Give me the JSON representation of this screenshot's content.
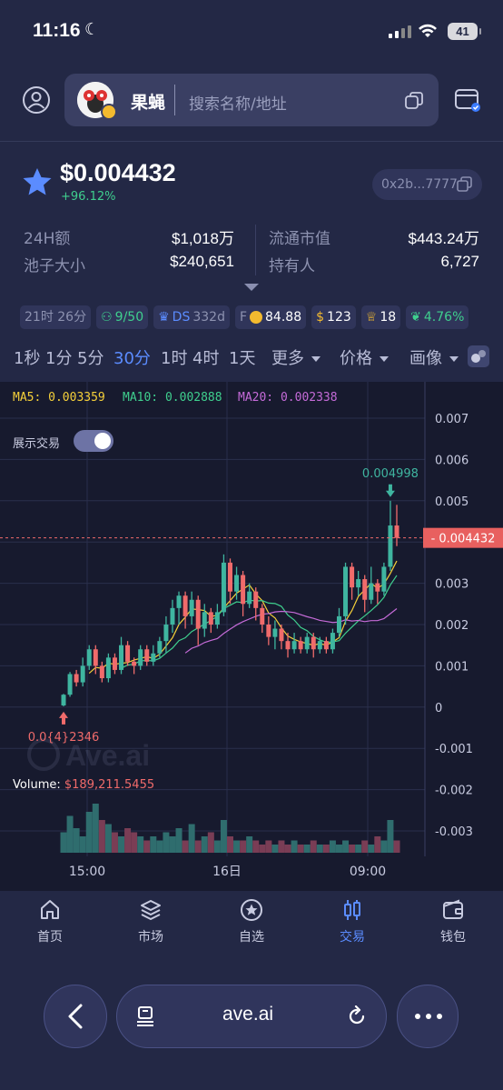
{
  "status_bar": {
    "time": "11:16",
    "battery": "41"
  },
  "header": {
    "token_name": "果蝇",
    "search_placeholder": "搜索名称/地址"
  },
  "token": {
    "price": "$0.004432",
    "change": "+96.12%",
    "address": "0x2b...7777",
    "stats": [
      {
        "label": "24H额",
        "value": "$1,018万"
      },
      {
        "label": "池子大小",
        "value": "$240,651"
      },
      {
        "label": "流通市值",
        "value": "$443.24万"
      },
      {
        "label": "持有人",
        "value": "6,727"
      }
    ],
    "chips": [
      "21时 26分",
      "9/50",
      "DS",
      "332d",
      "F",
      "84.88",
      "123",
      "18",
      "4.76%"
    ]
  },
  "timeframes": [
    "1秒",
    "1分",
    "5分",
    "30分",
    "1时",
    "4时",
    "1天"
  ],
  "active_timeframe": "30分",
  "dropdowns": [
    "更多",
    "价格",
    "画像"
  ],
  "chart_labels": {
    "ma5": "MA5: 0.003359",
    "ma10": "MA10: 0.002888",
    "ma20": "MA20: 0.002338",
    "toggle": "展示交易",
    "watermark": "Ave.ai",
    "volume_label": "Volume: ",
    "volume_value": "$189,211.5455",
    "high_label": "0.004998",
    "low_label": "0.0{4}2346",
    "current_label": "0.004432"
  },
  "chart_data": {
    "type": "candlestick",
    "x_ticks": [
      "15:00",
      "16日",
      "09:00"
    ],
    "y_ticks": [
      "0.007",
      "0.006",
      "0.005",
      "0.004",
      "0.003",
      "0.002",
      "0.001",
      "0",
      "-0.001",
      "-0.002",
      "-0.003"
    ],
    "ylim": [
      -0.0034,
      0.0075
    ],
    "grid": true,
    "ma_colors": {
      "ma5": "#f5d03a",
      "ma10": "#3fcf8e",
      "ma20": "#c56bd8"
    },
    "colors": {
      "up": "#3fb5a0",
      "down": "#f06b6b"
    },
    "candles": [
      [
        4e-05,
        0.0003,
        2e-05,
        0.00032
      ],
      [
        0.0003,
        0.0008,
        0.00025,
        0.00085
      ],
      [
        0.0008,
        0.0006,
        0.0005,
        0.0009
      ],
      [
        0.0006,
        0.001,
        0.0005,
        0.0012
      ],
      [
        0.001,
        0.0014,
        0.0009,
        0.0015
      ],
      [
        0.0014,
        0.001,
        0.0008,
        0.0015
      ],
      [
        0.001,
        0.0007,
        0.0006,
        0.0011
      ],
      [
        0.0007,
        0.0012,
        0.0006,
        0.0013
      ],
      [
        0.0012,
        0.0009,
        0.0008,
        0.0013
      ],
      [
        0.0009,
        0.0015,
        0.0008,
        0.0017
      ],
      [
        0.0015,
        0.0011,
        0.001,
        0.0016
      ],
      [
        0.0011,
        0.001,
        0.0008,
        0.0012
      ],
      [
        0.001,
        0.0014,
        0.0009,
        0.0015
      ],
      [
        0.0014,
        0.0011,
        0.001,
        0.0015
      ],
      [
        0.0011,
        0.0013,
        0.001,
        0.0015
      ],
      [
        0.0013,
        0.0016,
        0.0012,
        0.0017
      ],
      [
        0.0016,
        0.002,
        0.0013,
        0.0022
      ],
      [
        0.002,
        0.0024,
        0.0018,
        0.0026
      ],
      [
        0.0024,
        0.0027,
        0.002,
        0.0028
      ],
      [
        0.0027,
        0.0022,
        0.0019,
        0.0028
      ],
      [
        0.0022,
        0.0026,
        0.002,
        0.0028
      ],
      [
        0.0026,
        0.0019,
        0.0015,
        0.0027
      ],
      [
        0.0019,
        0.0023,
        0.0017,
        0.0025
      ],
      [
        0.0023,
        0.002,
        0.0018,
        0.0024
      ],
      [
        0.002,
        0.0023,
        0.0019,
        0.0025
      ],
      [
        0.0023,
        0.0035,
        0.0022,
        0.0037
      ],
      [
        0.0035,
        0.0028,
        0.0025,
        0.0036
      ],
      [
        0.0028,
        0.0032,
        0.0026,
        0.0034
      ],
      [
        0.0032,
        0.0025,
        0.0022,
        0.0033
      ],
      [
        0.0025,
        0.0028,
        0.0024,
        0.003
      ],
      [
        0.0028,
        0.0024,
        0.0021,
        0.0029
      ],
      [
        0.0024,
        0.002,
        0.0018,
        0.0025
      ],
      [
        0.002,
        0.0017,
        0.0015,
        0.0022
      ],
      [
        0.0017,
        0.0019,
        0.0014,
        0.0021
      ],
      [
        0.0019,
        0.0016,
        0.0014,
        0.002
      ],
      [
        0.0016,
        0.0014,
        0.0012,
        0.0018
      ],
      [
        0.0014,
        0.0016,
        0.0013,
        0.0018
      ],
      [
        0.0016,
        0.0014,
        0.0013,
        0.0017
      ],
      [
        0.0014,
        0.0017,
        0.0013,
        0.0018
      ],
      [
        0.0017,
        0.0014,
        0.0012,
        0.0018
      ],
      [
        0.0014,
        0.0016,
        0.0013,
        0.0017
      ],
      [
        0.0016,
        0.0014,
        0.0013,
        0.0017
      ],
      [
        0.0014,
        0.0018,
        0.0013,
        0.0019
      ],
      [
        0.0018,
        0.0022,
        0.0017,
        0.0024
      ],
      [
        0.0022,
        0.0034,
        0.002,
        0.0035
      ],
      [
        0.0034,
        0.0029,
        0.0026,
        0.0035
      ],
      [
        0.0029,
        0.0031,
        0.0027,
        0.0033
      ],
      [
        0.0031,
        0.0026,
        0.0023,
        0.0032
      ],
      [
        0.0026,
        0.003,
        0.0025,
        0.0034
      ],
      [
        0.003,
        0.0028,
        0.0025,
        0.0031
      ],
      [
        0.0028,
        0.0034,
        0.0027,
        0.0035
      ],
      [
        0.0034,
        0.0044,
        0.0033,
        0.005
      ],
      [
        0.0044,
        0.0041,
        0.0039,
        0.0049
      ]
    ],
    "volumes": [
      5,
      9,
      6,
      4,
      10,
      12,
      8,
      7,
      5,
      4,
      6,
      5,
      4,
      3,
      4,
      3,
      5,
      4,
      6,
      3,
      7,
      3,
      4,
      5,
      3,
      8,
      4,
      3,
      3,
      4,
      3,
      2,
      3,
      2,
      3,
      2,
      3,
      2,
      2,
      3,
      2,
      2,
      3,
      2,
      3,
      2,
      2,
      3,
      2,
      4,
      3,
      8,
      3
    ],
    "volume_up": [
      true,
      true,
      true,
      true,
      true,
      true,
      false,
      true,
      false,
      true,
      false,
      false,
      true,
      false,
      true,
      true,
      true,
      true,
      true,
      false,
      true,
      false,
      true,
      false,
      true,
      true,
      false,
      true,
      false,
      true,
      false,
      false,
      false,
      true,
      false,
      false,
      true,
      false,
      true,
      false,
      true,
      false,
      true,
      true,
      true,
      false,
      true,
      false,
      true,
      false,
      true,
      true,
      false
    ]
  },
  "bottom_nav": [
    {
      "label": "首页",
      "icon": "home-icon"
    },
    {
      "label": "市场",
      "icon": "layers-icon"
    },
    {
      "label": "自选",
      "icon": "star-circle-icon"
    },
    {
      "label": "交易",
      "icon": "candles-icon"
    },
    {
      "label": "钱包",
      "icon": "wallet-icon"
    }
  ],
  "active_nav": "交易",
  "browser": {
    "url": "ave.ai"
  }
}
